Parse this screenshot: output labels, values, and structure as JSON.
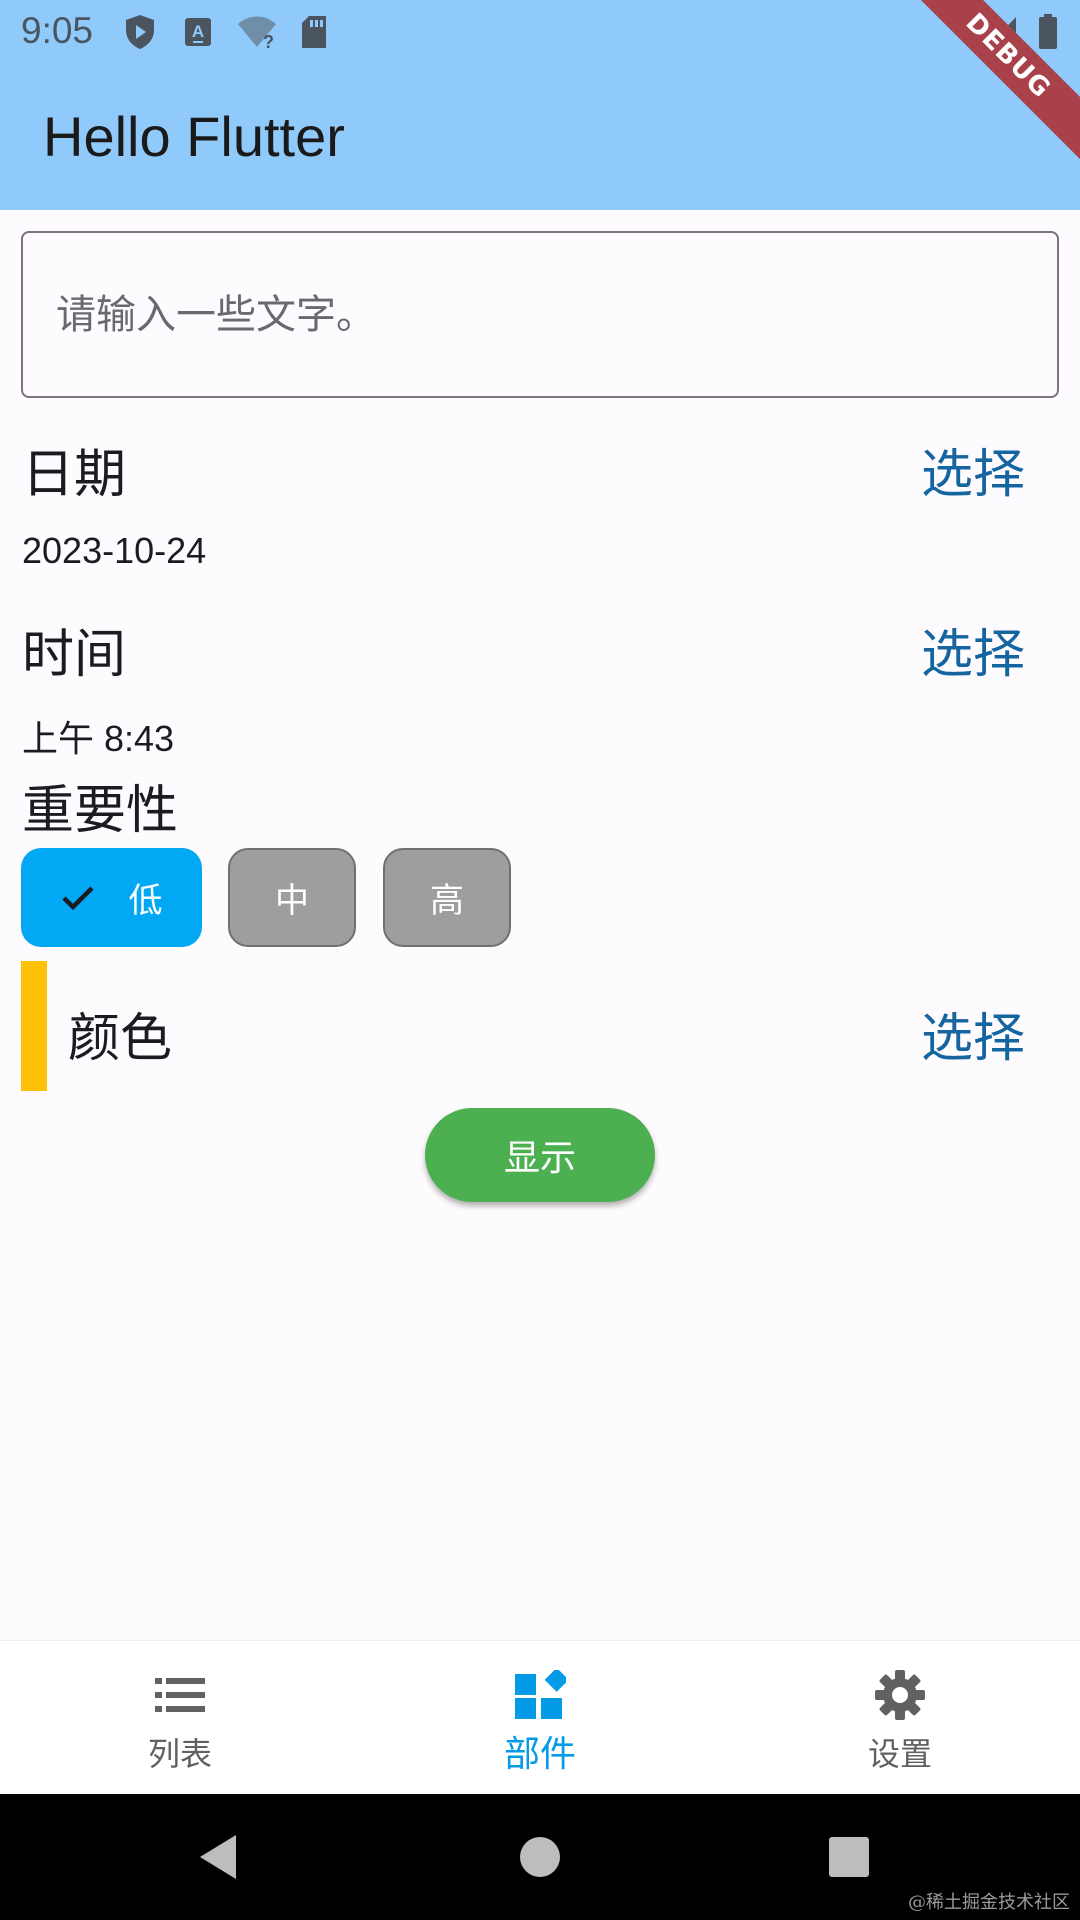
{
  "status_bar": {
    "time": "9:05",
    "icons": [
      "shield-play-icon",
      "a-box-icon",
      "wifi-question-icon",
      "sd-card-icon",
      "signal-icon",
      "battery-icon"
    ]
  },
  "app_bar": {
    "title": "Hello Flutter",
    "debug_banner": "DEBUG",
    "color": "#90cafa"
  },
  "form": {
    "text_field": {
      "placeholder": "请输入一些文字。",
      "value": ""
    },
    "date": {
      "label": "日期",
      "action": "选择",
      "value": "2023-10-24"
    },
    "time": {
      "label": "时间",
      "action": "选择",
      "value": "上午 8:43"
    },
    "importance": {
      "label": "重要性",
      "options": [
        {
          "label": "低",
          "selected": true
        },
        {
          "label": "中",
          "selected": false
        },
        {
          "label": "高",
          "selected": false
        }
      ]
    },
    "color": {
      "label": "颜色",
      "action": "选择",
      "swatch": "#ffc107"
    },
    "show_button": "显示"
  },
  "bottom_nav": {
    "items": [
      {
        "label": "列表",
        "icon": "list-icon",
        "active": false
      },
      {
        "label": "部件",
        "icon": "widgets-icon",
        "active": true
      },
      {
        "label": "设置",
        "icon": "settings-icon",
        "active": false
      }
    ],
    "active_color": "#039be5"
  },
  "system_nav": {
    "buttons": [
      "back-icon",
      "home-icon",
      "recents-icon"
    ]
  },
  "watermark": "@稀土掘金技术社区"
}
